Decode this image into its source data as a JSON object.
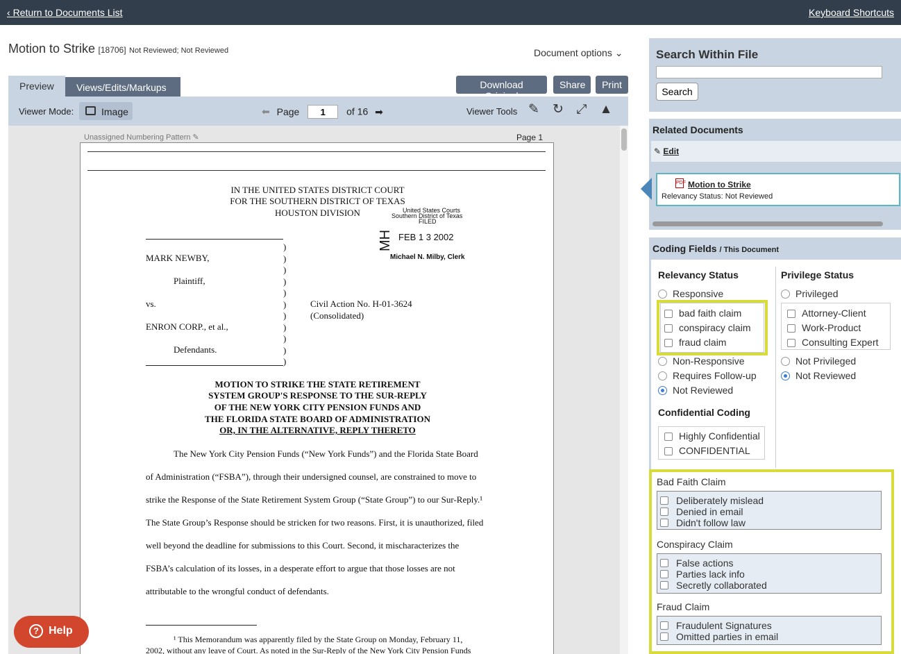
{
  "topbar": {
    "back_label": "Return to Documents List",
    "shortcuts_label": "Keyboard Shortcuts"
  },
  "document": {
    "title": "Motion to Strike",
    "id": "[18706]",
    "status": "Not Reviewed; Not Reviewed",
    "options_label": "Document options"
  },
  "tabs": {
    "preview": "Preview",
    "views": "Views/Edits/Markups"
  },
  "actions": {
    "download": "Download Original",
    "share": "Share",
    "print": "Print"
  },
  "viewer": {
    "mode_label": "Viewer Mode:",
    "mode_value": "Image",
    "page_label": "Page",
    "page_value": "1",
    "page_total": "of 16",
    "tools_label": "Viewer Tools"
  },
  "page": {
    "numbering": "Unassigned Numbering Pattern",
    "page_label": "Page 1",
    "court": [
      "IN THE UNITED STATES DISTRICT COURT",
      "FOR THE SOUTHERN DISTRICT OF TEXAS",
      "HOUSTON DIVISION"
    ],
    "stamp": {
      "line1": "United States Courts",
      "line2": "Southern District of Texas",
      "line3": "FILED",
      "date": "FEB 1 3 2002",
      "clerk": "Michael N. Milby, Clerk",
      "initials": "MH"
    },
    "parties": [
      "MARK NEWBY,",
      "Plaintiff,",
      "vs.",
      "ENRON CORP., et al.,",
      "Defendants."
    ],
    "civil_action": [
      "Civil Action No. H-01-3624",
      "(Consolidated)"
    ],
    "motion_title": [
      "MOTION TO STRIKE THE STATE RETIREMENT",
      "SYSTEM GROUP'S RESPONSE TO THE SUR-REPLY",
      "OF THE NEW YORK CITY PENSION FUNDS AND",
      "THE FLORIDA STATE BOARD OF ADMINISTRATION",
      "OR, IN THE ALTERNATIVE, REPLY THERETO"
    ],
    "body": [
      "The New York City Pension Funds (“New York Funds”) and the Florida State Board",
      "of Administration (“FSBA”), through their undersigned counsel, are constrained to move to",
      "strike the Response of the State Retirement System Group (“State Group”) to our Sur-Reply.¹",
      "The State Group’s Response should be stricken for two reasons.  First, it is unauthorized, filed",
      "well beyond the deadline for submissions to this Court.  Second, it mischaracterizes the",
      "FSBA’s calculation of its losses, in a desperate effort to argue that those losses are not",
      "attributable to the wrongful conduct of defendants."
    ],
    "footnote": [
      "¹      This Memorandum was apparently filed by the State Group on Monday, February 11,",
      "2002, without any leave of Court.  As noted in the Sur-Reply of the New York City Pension Funds"
    ]
  },
  "search": {
    "title": "Search Within File",
    "button": "Search",
    "value": ""
  },
  "related": {
    "title": "Related Documents",
    "edit": "Edit",
    "item_name": "Motion to Strike",
    "item_status": "Relevancy Status: Not Reviewed"
  },
  "coding": {
    "title": "Coding Fields",
    "subtitle": "/ This Document",
    "relevancy_title": "Relevancy Status",
    "responsive": "Responsive",
    "responsive_sub": [
      "bad faith claim",
      "conspiracy claim",
      "fraud claim"
    ],
    "relevancy_rest": [
      "Non-Responsive",
      "Requires Follow-up",
      "Not Reviewed"
    ],
    "privilege_title": "Privilege Status",
    "privileged": "Privileged",
    "privileged_sub": [
      "Attorney-Client",
      "Work-Product",
      "Consulting Expert"
    ],
    "privilege_rest": [
      "Not Privileged",
      "Not Reviewed"
    ],
    "confidential_title": "Confidential Coding",
    "confidential": [
      "Highly Confidential",
      "CONFIDENTIAL"
    ],
    "bad_faith": {
      "label": "Bad Faith Claim",
      "options": [
        "Deliberately mislead",
        "Denied in email",
        "Didn't follow law"
      ]
    },
    "conspiracy": {
      "label": "Conspiracy Claim",
      "options": [
        "False actions",
        "Parties lack info",
        "Secretly collaborated"
      ]
    },
    "fraud": {
      "label": "Fraud Claim",
      "options": [
        "Fraudulent Signatures",
        "Omitted parties in email"
      ]
    }
  },
  "help": {
    "label": "Help"
  },
  "colors": {
    "topbar": "#333e4d",
    "panel": "#c9d4e2",
    "button": "#5d6c81",
    "highlight": "#d8dc3a",
    "help": "#d2462d",
    "radio_selected": "#3a7bd5"
  }
}
